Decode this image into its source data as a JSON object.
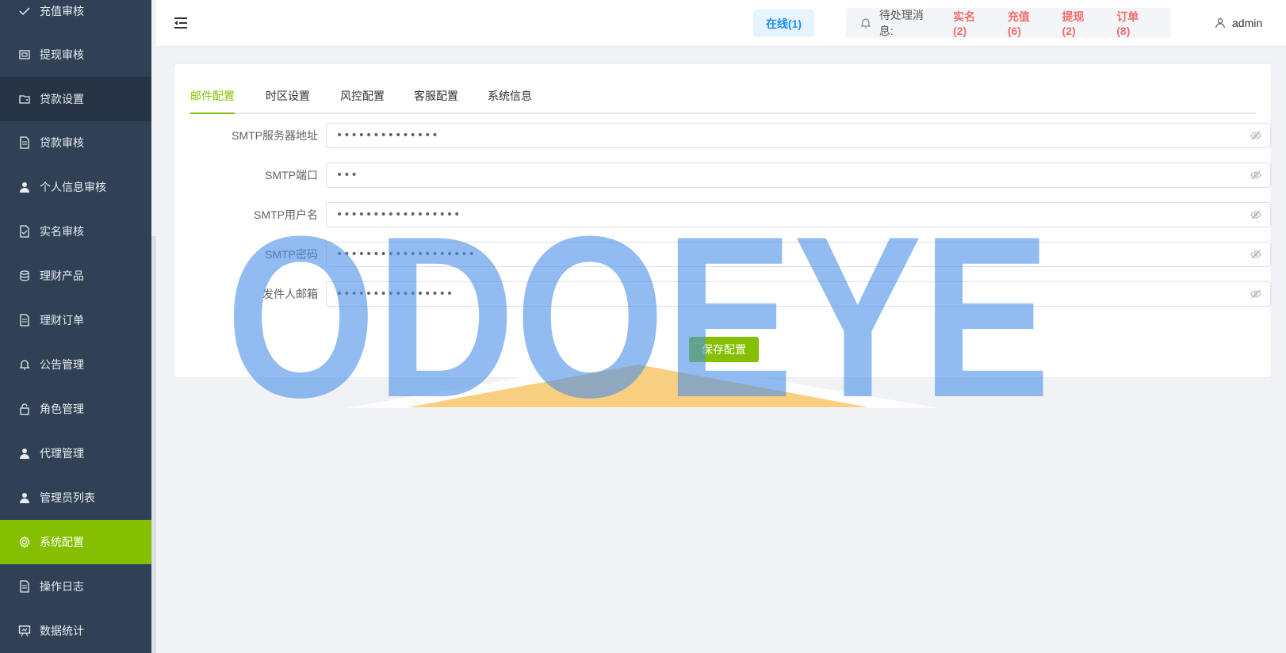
{
  "sidebar": {
    "items": [
      {
        "label": "充值审核",
        "icon": "check-icon"
      },
      {
        "label": "提现审核",
        "icon": "wallet-icon"
      },
      {
        "label": "贷款设置",
        "icon": "folder-icon"
      },
      {
        "label": "贷款审核",
        "icon": "document-icon"
      },
      {
        "label": "个人信息审核",
        "icon": "user-icon"
      },
      {
        "label": "实名审核",
        "icon": "document-check-icon"
      },
      {
        "label": "理财产品",
        "icon": "coins-icon"
      },
      {
        "label": "理财订单",
        "icon": "document-icon"
      },
      {
        "label": "公告管理",
        "icon": "bell-icon"
      },
      {
        "label": "角色管理",
        "icon": "lock-icon"
      },
      {
        "label": "代理管理",
        "icon": "user-icon"
      },
      {
        "label": "管理员列表",
        "icon": "user-icon"
      },
      {
        "label": "系统配置",
        "icon": "gear-icon"
      },
      {
        "label": "操作日志",
        "icon": "document-icon"
      },
      {
        "label": "数据统计",
        "icon": "presentation-icon"
      }
    ],
    "active_index": 12
  },
  "header": {
    "online": "在线(1)",
    "pending_label": "待处理消息:",
    "pending": [
      {
        "label": "实名(2)"
      },
      {
        "label": "充值(6)"
      },
      {
        "label": "提现(2)"
      },
      {
        "label": "订单(8)"
      }
    ],
    "user": "admin"
  },
  "tabs": [
    {
      "label": "邮件配置"
    },
    {
      "label": "时区设置"
    },
    {
      "label": "风控配置"
    },
    {
      "label": "客服配置"
    },
    {
      "label": "系统信息"
    }
  ],
  "form": {
    "fields": [
      {
        "label": "SMTP服务器地址",
        "value": "••••••••••••••"
      },
      {
        "label": "SMTP端口",
        "value": "•••"
      },
      {
        "label": "SMTP用户名",
        "value": "•••••••••••••••••"
      },
      {
        "label": "SMTP密码",
        "value": "•••••••••••••••••••"
      },
      {
        "label": "发件人邮箱",
        "value": "••••••••••••••••"
      }
    ],
    "save_label": "保存配置"
  },
  "watermark": {
    "text": "ODOEYE"
  },
  "colors": {
    "accent": "#84c000",
    "sidebar": "#304156",
    "danger": "#f56c6c",
    "primary": "#1890ff"
  }
}
